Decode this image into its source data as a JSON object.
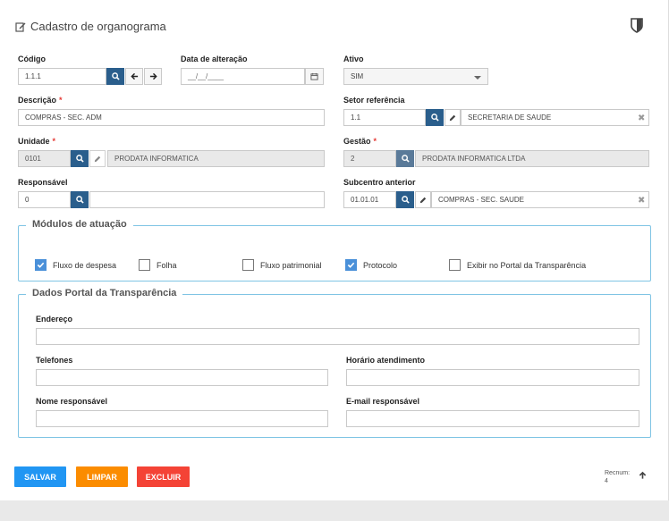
{
  "title": "Cadastro de organograma",
  "icons": {
    "title": "edit-icon",
    "shield": "shield-icon",
    "search": "search-icon",
    "prev": "arrow-left-icon",
    "next": "arrow-right-icon",
    "calendar": "calendar-icon",
    "pencil": "pencil-icon",
    "clear": "close-icon",
    "top": "arrow-up-icon"
  },
  "codigo": {
    "label": "Código",
    "value": "1.1.1"
  },
  "data_alteracao": {
    "label": "Data de alteração",
    "value": "__/__/____"
  },
  "ativo": {
    "label": "Ativo",
    "value": "SIM"
  },
  "descricao": {
    "label": "Descrição",
    "value": "COMPRAS - SEC. ADM"
  },
  "setor_referencia": {
    "label": "Setor referência",
    "code": "1.1",
    "name": "SECRETARIA DE SAUDE"
  },
  "unidade": {
    "label": "Unidade",
    "code": "0101",
    "name": "PRODATA INFORMATICA"
  },
  "gestao": {
    "label": "Gestão",
    "code": "2",
    "name": "PRODATA INFORMATICA LTDA"
  },
  "responsavel": {
    "label": "Responsável",
    "code": "0",
    "name": ""
  },
  "subcentro_anterior": {
    "label": "Subcentro anterior",
    "code": "01.01.01",
    "name": "COMPRAS - SEC. SAUDE"
  },
  "required_mark": "*",
  "modulos": {
    "legend": "Módulos de atuação",
    "items": [
      {
        "label": "Fluxo de despesa",
        "checked": true
      },
      {
        "label": "Folha",
        "checked": false
      },
      {
        "label": "Fluxo patrimonial",
        "checked": false
      },
      {
        "label": "Protocolo",
        "checked": true
      },
      {
        "label": "Exibir no Portal da Transparência",
        "checked": false
      }
    ]
  },
  "portal": {
    "legend": "Dados Portal da Transparência",
    "endereco": {
      "label": "Endereço",
      "value": ""
    },
    "telefones": {
      "label": "Telefones",
      "value": ""
    },
    "horario": {
      "label": "Horário atendimento",
      "value": ""
    },
    "nome_responsavel": {
      "label": "Nome responsável",
      "value": ""
    },
    "email_responsavel": {
      "label": "E-mail responsável",
      "value": ""
    }
  },
  "actions": {
    "save": "SALVAR",
    "clear": "LIMPAR",
    "delete": "EXCLUIR"
  },
  "colors": {
    "save": "#2196f3",
    "clear": "#fb8c00",
    "delete": "#f44336",
    "accent": "#2a5e8c",
    "fieldset": "#7fc4e4"
  },
  "recnum": {
    "label": "Recnum:",
    "value": "4"
  }
}
